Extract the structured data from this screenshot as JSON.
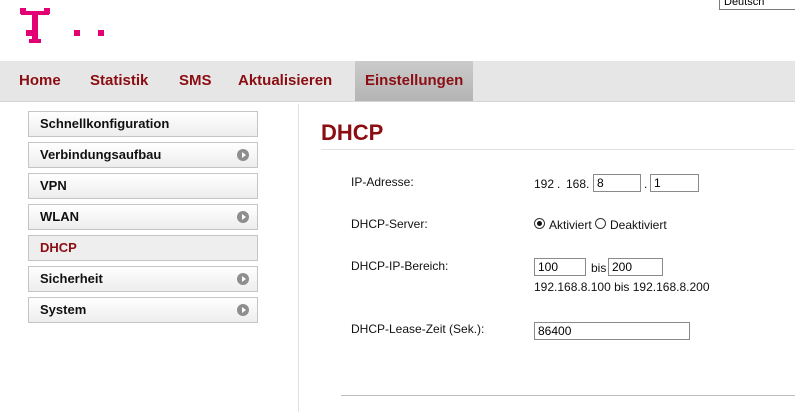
{
  "language": {
    "selected": "Deutsch"
  },
  "nav": {
    "items": [
      "Home",
      "Statistik",
      "SMS",
      "Aktualisieren",
      "Einstellungen"
    ],
    "active": "Einstellungen"
  },
  "sidebar": {
    "items": [
      "Schnellkonfiguration",
      "Verbindungsaufbau",
      "VPN",
      "WLAN",
      "DHCP",
      "Sicherheit",
      "System"
    ],
    "active": "DHCP"
  },
  "page": {
    "title": "DHCP",
    "ip": {
      "label": "IP-Adresse:",
      "octet1": "192",
      "octet2": "168",
      "octet3": "8",
      "octet4": "1",
      "sep": "."
    },
    "dhcp_server": {
      "label": "DHCP-Server:",
      "option_on": "Aktiviert",
      "option_off": "Deaktiviert",
      "selected": "Aktiviert"
    },
    "range": {
      "label": "DHCP-IP-Bereich:",
      "start": "100",
      "bis": "bis",
      "end": "200",
      "summary": "192.168.8.100 bis 192.168.8.200"
    },
    "lease": {
      "label": "DHCP-Lease-Zeit (Sek.):",
      "value": "86400"
    }
  },
  "colors": {
    "brand_magenta": "#e20074",
    "accent_red": "#8b0d12"
  },
  "icons": {
    "logo": "telekom-logo",
    "submenu": "arrow-right-icon"
  }
}
